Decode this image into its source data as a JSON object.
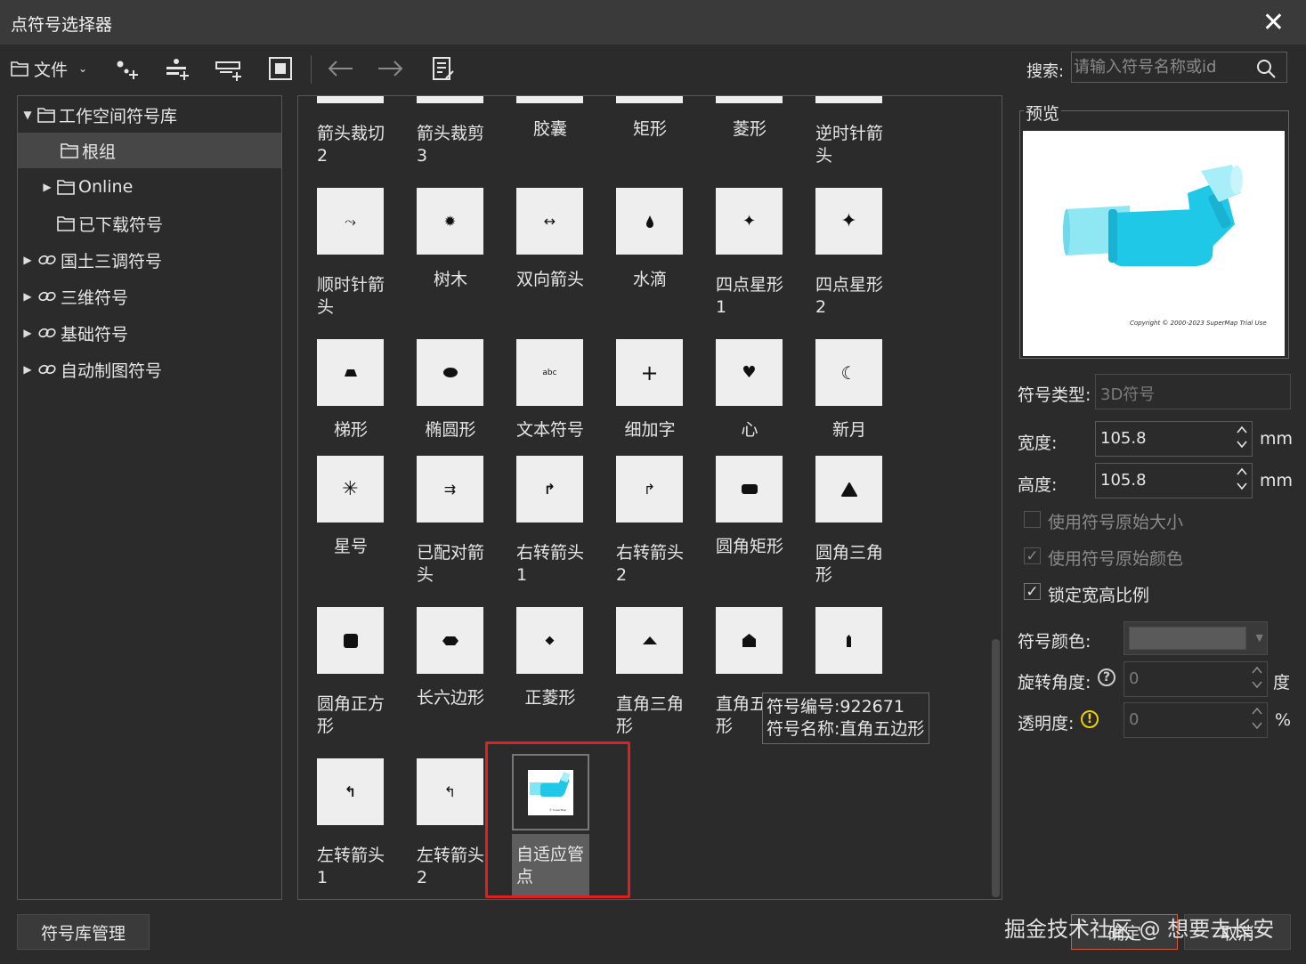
{
  "window": {
    "title": "点符号选择器",
    "close": "✕"
  },
  "toolbar": {
    "file_label": "文件",
    "search_label": "搜索:",
    "search_placeholder": "请输入符号名称或id"
  },
  "tree": {
    "items": [
      {
        "label": "工作空间符号库",
        "expanded": true,
        "icon": "folder-icon"
      },
      {
        "label": "根组",
        "selected": true,
        "icon": "folder-icon"
      },
      {
        "label": "Online",
        "icon": "folder-icon"
      },
      {
        "label": "已下载符号",
        "icon": "folder-icon"
      },
      {
        "label": "国土三调符号",
        "icon": "link-icon"
      },
      {
        "label": "三维符号",
        "icon": "link-icon"
      },
      {
        "label": "基础符号",
        "icon": "link-icon"
      },
      {
        "label": "自动制图符号",
        "icon": "link-icon"
      }
    ]
  },
  "grid": {
    "top_labels": [
      "箭头裁切\n2",
      "箭头裁剪\n3",
      "胶囊",
      "矩形",
      "菱形",
      "逆时针箭\n头"
    ],
    "rows": [
      [
        "顺时针箭\n头",
        "树木",
        "双向箭头",
        "水滴",
        "四点星形\n1",
        "四点星形\n2"
      ],
      [
        "梯形",
        "椭圆形",
        "文本符号",
        "细加字",
        "心",
        "新月"
      ],
      [
        "星号",
        "已配对箭\n头",
        "右转箭头\n1",
        "右转箭头\n2",
        "圆角矩形",
        "圆角三角\n形"
      ],
      [
        "圆角正方\n形",
        "长六边形",
        "正菱形",
        "直角三角\n形",
        "直角五边\n形",
        ""
      ],
      [
        "左转箭头\n1",
        "左转箭头\n2",
        "自适应管\n点"
      ]
    ],
    "text_symbol_glyph": "abc",
    "tooltip": {
      "line1": "符号编号:922671",
      "line2": "符号名称:直角五边形"
    }
  },
  "preview": {
    "legend": "预览",
    "watermark": "Copyright © 2000-2023 SuperMap Trial Use"
  },
  "props": {
    "type_label": "符号类型:",
    "type_value": "3D符号",
    "width_label": "宽度:",
    "width_value": "105.8",
    "width_unit": "mm",
    "height_label": "高度:",
    "height_value": "105.8",
    "height_unit": "mm",
    "use_orig_size": "使用符号原始大小",
    "use_orig_color": "使用符号原始颜色",
    "lock_ratio": "锁定宽高比例",
    "color_label": "符号颜色:",
    "symbol_color": "#5a5a5a",
    "rotation_label": "旋转角度:",
    "rotation_value": "0",
    "rotation_unit": "度",
    "opacity_label": "透明度:",
    "opacity_value": "0",
    "opacity_unit": "%"
  },
  "footer": {
    "manage_button": "符号库管理",
    "ok_button": "确定",
    "cancel_button": "取消",
    "watermark": "掘金技术社区 @ 想要去长安"
  },
  "colors": {
    "highlight": "#e02020",
    "pipe": "#1ec8e6",
    "accent_warning": "#f0d000"
  }
}
